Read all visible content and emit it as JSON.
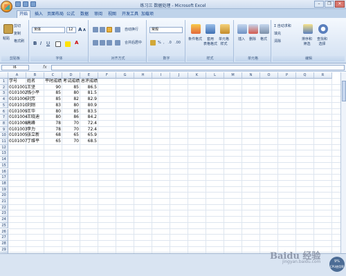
{
  "window": {
    "title": "练习三 数据处理 - Microsoft Excel",
    "min": "–",
    "max": "❐",
    "close": "✕"
  },
  "tabs": [
    "开始",
    "插入",
    "页面布局",
    "公式",
    "数据",
    "审阅",
    "视图",
    "开发工具",
    "加载项"
  ],
  "ribbon": {
    "clipboard": {
      "label": "剪贴板",
      "paste": "粘贴",
      "cut": "剪切",
      "copy": "复制",
      "format_painter": "格式刷"
    },
    "font": {
      "label": "字体",
      "font_name": "宋体",
      "font_size": "12",
      "bold": "B",
      "italic": "I",
      "underline": "U",
      "font_color": "A",
      "grow": "A",
      "shrink": "A"
    },
    "alignment": {
      "label": "对齐方式",
      "wrap": "自动换行",
      "merge": "合并后居中"
    },
    "number": {
      "label": "数字",
      "format": "常规",
      "percent": "%",
      "comma": ",",
      "inc": ".0",
      "dec": ".00"
    },
    "styles": {
      "label": "样式",
      "conditional": "条件格式",
      "table": "套用\n表格格式",
      "cell_styles": "单元格\n样式"
    },
    "cells": {
      "label": "单元格",
      "insert": "插入",
      "delete": "删除",
      "format": "格式"
    },
    "editing": {
      "label": "编辑",
      "autosum": "Σ 自动求和",
      "fill": "填充",
      "clear": "清除",
      "sort": "排序和\n筛选",
      "find": "查找和\n选择"
    }
  },
  "formula_bar": {
    "name_box": "I6",
    "fx": "fx",
    "content": ""
  },
  "columns": [
    "A",
    "B",
    "C",
    "D",
    "E",
    "F",
    "G",
    "H",
    "I",
    "J",
    "K",
    "L",
    "M",
    "N",
    "O",
    "P",
    "Q",
    "R"
  ],
  "rows": [
    "1",
    "2",
    "3",
    "4",
    "5",
    "6",
    "7",
    "8",
    "9",
    "10",
    "11",
    "12",
    "13",
    "14",
    "15",
    "16",
    "17",
    "18",
    "19",
    "20",
    "21",
    "22",
    "23",
    "24",
    "25",
    "26",
    "27",
    "28",
    "29",
    "30"
  ],
  "table": {
    "headers": [
      "学号",
      "姓名",
      "平时成绩",
      "考试成绩",
      "总评成绩"
    ],
    "rows": [
      [
        "0101001",
        "王坚",
        "90",
        "85",
        "86.5"
      ],
      [
        "0101002",
        "钱小平",
        "85",
        "80",
        "81.5"
      ],
      [
        "0101006",
        "刘芳",
        "85",
        "82",
        "82.9"
      ],
      [
        "0101010",
        "刘刚",
        "83",
        "80",
        "80.9"
      ],
      [
        "0101009",
        "王华",
        "80",
        "85",
        "83.5"
      ],
      [
        "0101004",
        "王晓迪",
        "80",
        "86",
        "84.2"
      ],
      [
        "0101008",
        "高峰",
        "78",
        "70",
        "72.4"
      ],
      [
        "0101003",
        "李力",
        "78",
        "70",
        "72.4"
      ],
      [
        "0101005",
        "张立新",
        "68",
        "65",
        "65.9"
      ],
      [
        "0101007",
        "丁维平",
        "65",
        "70",
        "68.5"
      ]
    ]
  },
  "watermark": {
    "main": "Baidu 经验",
    "sub": "jingyan.baidu.com"
  },
  "badge": {
    "line1": "9%",
    "line2": "CPU使用率"
  }
}
